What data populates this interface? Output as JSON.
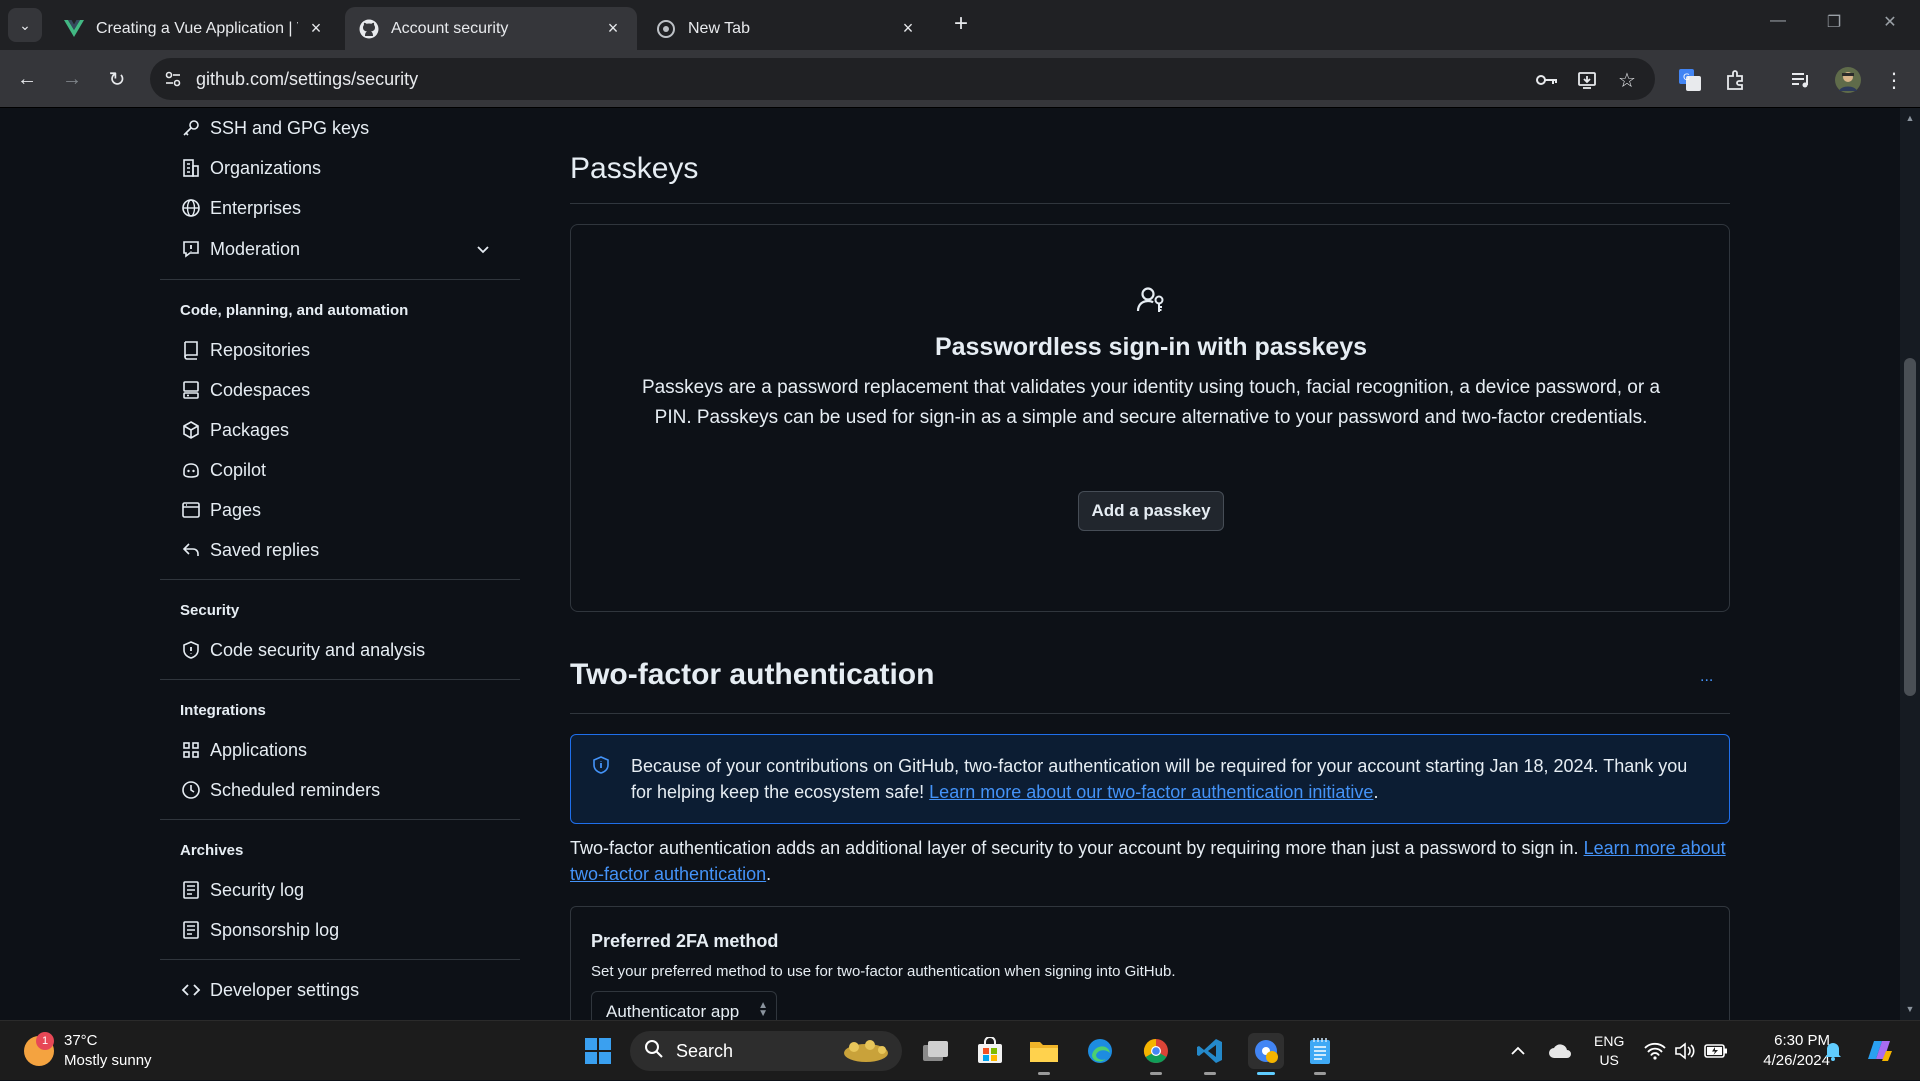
{
  "browser": {
    "tabs": [
      {
        "title": "Creating a Vue Application | Vu",
        "active": false
      },
      {
        "title": "Account security",
        "active": true
      },
      {
        "title": "New Tab",
        "active": false
      }
    ],
    "url": "github.com/settings/security"
  },
  "sidebar": {
    "top_items": [
      {
        "label": "SSH and GPG keys",
        "icon": "key-icon"
      },
      {
        "label": "Organizations",
        "icon": "organization-icon"
      },
      {
        "label": "Enterprises",
        "icon": "globe-icon"
      },
      {
        "label": "Moderation",
        "icon": "report-icon"
      }
    ],
    "sections": [
      {
        "heading": "Code, planning, and automation",
        "items": [
          {
            "label": "Repositories",
            "icon": "repo-icon"
          },
          {
            "label": "Codespaces",
            "icon": "codespaces-icon"
          },
          {
            "label": "Packages",
            "icon": "package-icon"
          },
          {
            "label": "Copilot",
            "icon": "copilot-icon"
          },
          {
            "label": "Pages",
            "icon": "browser-icon"
          },
          {
            "label": "Saved replies",
            "icon": "reply-icon"
          }
        ]
      },
      {
        "heading": "Security",
        "items": [
          {
            "label": "Code security and analysis",
            "icon": "shield-icon"
          }
        ]
      },
      {
        "heading": "Integrations",
        "items": [
          {
            "label": "Applications",
            "icon": "apps-icon"
          },
          {
            "label": "Scheduled reminders",
            "icon": "clock-icon"
          }
        ]
      },
      {
        "heading": "Archives",
        "items": [
          {
            "label": "Security log",
            "icon": "log-icon"
          },
          {
            "label": "Sponsorship log",
            "icon": "log-icon"
          }
        ]
      }
    ],
    "bottom_item": {
      "label": "Developer settings",
      "icon": "code-icon"
    }
  },
  "passkeys": {
    "heading": "Passkeys",
    "title": "Passwordless sign-in with passkeys",
    "description": "Passkeys are a password replacement that validates your identity using touch, facial recognition, a device password, or a PIN. Passkeys can be used for sign-in as a simple and secure alternative to your password and two-factor credentials.",
    "button": "Add a passkey"
  },
  "two_factor": {
    "heading": "Two-factor authentication",
    "more": "...",
    "flash_text": "Because of your contributions on GitHub, two-factor authentication will be required for your account starting Jan 18, 2024. Thank you for helping keep the ecosystem safe! ",
    "flash_link": "Learn more about our two-factor authentication initiative",
    "flash_end": ".",
    "desc_text": "Two-factor authentication adds an additional layer of security to your account by requiring more than just a password to sign in. ",
    "desc_link": "Learn more about two-factor authentication",
    "desc_end": ".",
    "method_title": "Preferred 2FA method",
    "method_desc": "Set your preferred method to use for two-factor authentication when signing into GitHub.",
    "method_value": "Authenticator app"
  },
  "taskbar": {
    "weather_badge": "1",
    "temperature": "37°C",
    "condition": "Mostly sunny",
    "search": "Search",
    "lang1": "ENG",
    "lang2": "US",
    "time": "6:30 PM",
    "date": "4/26/2024"
  },
  "colors": {
    "accent": "#4493f8",
    "background": "#0d1117",
    "border": "#30363d"
  }
}
